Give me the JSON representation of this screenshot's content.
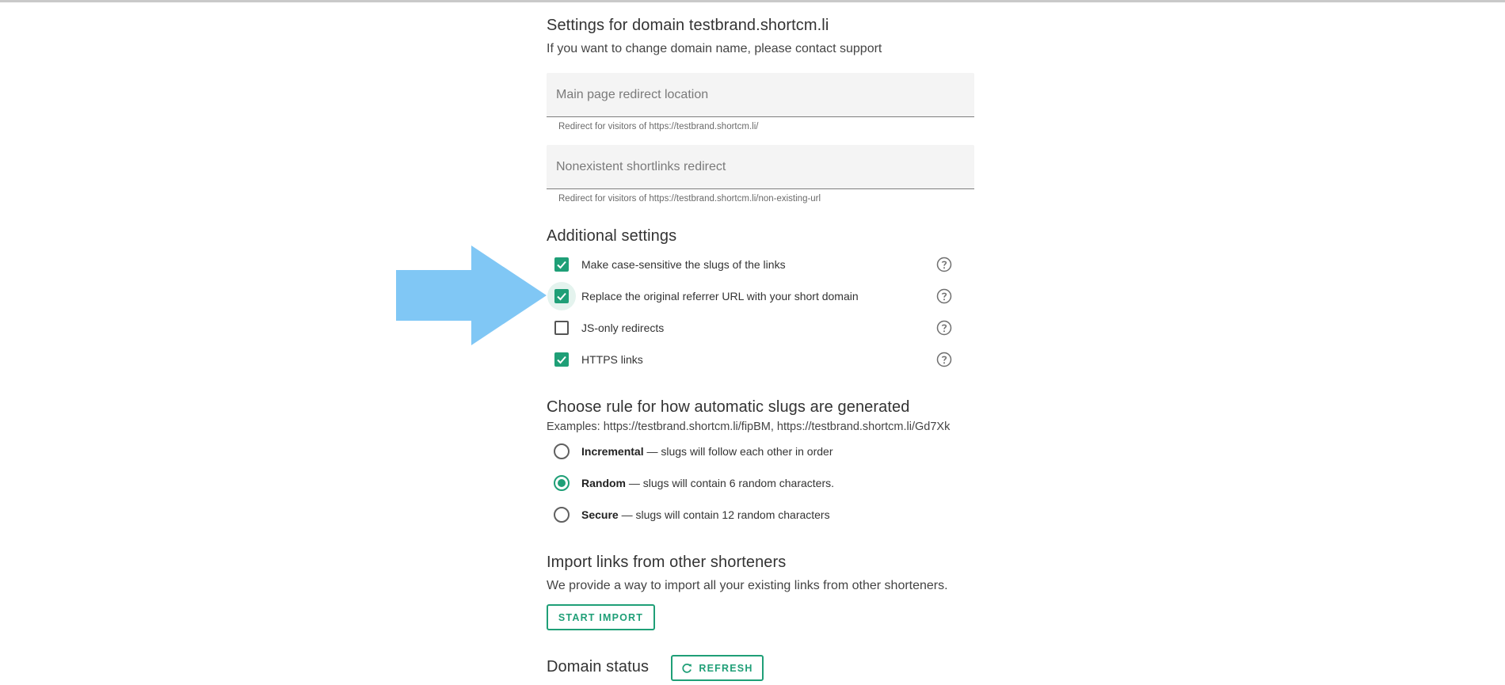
{
  "settings": {
    "title": "Settings for domain testbrand.shortcm.li",
    "subtitle": "If you want to change domain name, please contact support"
  },
  "fields": [
    {
      "placeholder": "Main page redirect location",
      "value": "",
      "helper": "Redirect for visitors of https://testbrand.shortcm.li/"
    },
    {
      "placeholder": "Nonexistent shortlinks redirect",
      "value": "",
      "helper": "Redirect for visitors of https://testbrand.shortcm.li/non-existing-url"
    }
  ],
  "additional": {
    "title": "Additional settings",
    "options": [
      {
        "label": "Make case-sensitive the slugs of the links",
        "checked": true,
        "icon": "help-circle-icon"
      },
      {
        "label": "Replace the original referrer URL with your short domain",
        "checked": true,
        "icon": "help-circle-icon"
      },
      {
        "label": "JS-only redirects",
        "checked": false,
        "icon": "help-circle-icon"
      },
      {
        "label": "HTTPS links",
        "checked": true,
        "icon": "help-circle-icon"
      }
    ]
  },
  "slugs": {
    "title": "Choose rule for how automatic slugs are generated",
    "examples": "Examples: https://testbrand.shortcm.li/fipBM, https://testbrand.shortcm.li/Gd7Xk",
    "options": [
      {
        "name": "Incremental",
        "desc": " — slugs will follow each other in order",
        "selected": false
      },
      {
        "name": "Random",
        "desc": " — slugs will contain 6 random characters.",
        "selected": true
      },
      {
        "name": "Secure",
        "desc": " — slugs will contain 12 random characters",
        "selected": false
      }
    ]
  },
  "import": {
    "title": "Import links from other shorteners",
    "description": "We provide a way to import all your existing links from other shorteners.",
    "button": "START IMPORT"
  },
  "domain_status": {
    "title": "Domain status",
    "refresh_button": "REFRESH",
    "refresh_icon": "refresh-icon"
  },
  "colors": {
    "accent": "#1f9f77",
    "arrow": "#80c7f5"
  }
}
